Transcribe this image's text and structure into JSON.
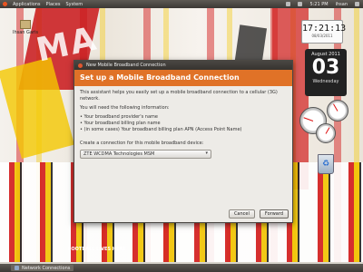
{
  "top_panel": {
    "menus": [
      "Applications",
      "Places",
      "System"
    ],
    "time": "5:21 PM",
    "user": "ihsan"
  },
  "desktop": {
    "icons": [
      {
        "label": "Ihsan Garis"
      }
    ],
    "wallpaper_text": "MA",
    "wallpaper_footer": "FOOTBALL LIVES HERE"
  },
  "widgets": {
    "clock": {
      "time": "17:21:13",
      "date": "08/03/2011"
    },
    "calendar": {
      "month": "August 2011",
      "day": "03",
      "weekday": "Wednesday"
    },
    "trash_label": "trash"
  },
  "dialog": {
    "window_title": "New Mobile Broadband Connection",
    "banner": "Set up a Mobile Broadband Connection",
    "intro": "This assistant helps you easily set up a mobile broadband connection to a cellular (3G) network.",
    "need_info": "You will need the following information:",
    "bullets": [
      "• Your broadband provider's name",
      "• Your broadband billing plan name",
      "• (in some cases) Your broadband billing plan APN (Access Point Name)"
    ],
    "device_label": "Create a connection for this mobile broadband device:",
    "device_selected": "ZTE WCDMA Technologies MSM",
    "buttons": {
      "cancel": "Cancel",
      "forward": "Forward"
    }
  },
  "taskbar": {
    "items": [
      {
        "label": "Network Connections"
      }
    ]
  },
  "colors": {
    "banner": "#e07227",
    "panel": "#3c3935"
  }
}
